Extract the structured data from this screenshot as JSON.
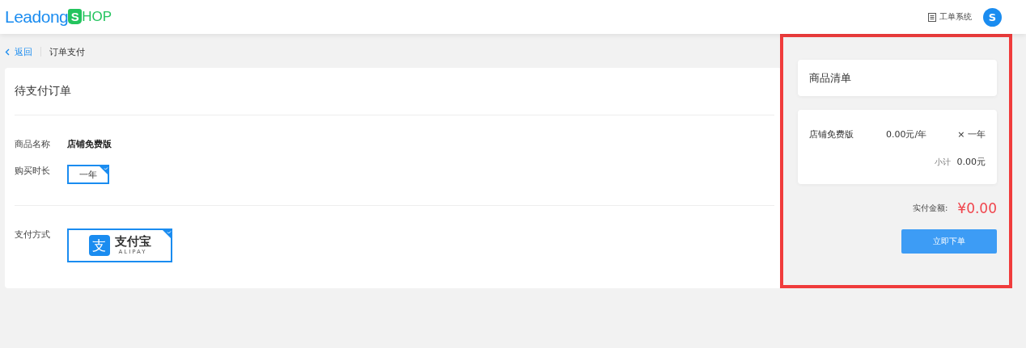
{
  "header": {
    "logo": {
      "text_1": "Leadong",
      "badge": "S",
      "text_2": "HOP"
    },
    "ticket_link": "工单系统",
    "avatar": "S"
  },
  "breadcrumb": {
    "back": "返回",
    "current": "订单支付"
  },
  "order": {
    "title": "待支付订单",
    "product": {
      "label": "商品名称",
      "value": "店铺免费版"
    },
    "duration": {
      "label": "购买时长",
      "options": [
        {
          "label": "一年",
          "selected": true
        }
      ]
    },
    "payment": {
      "label": "支付方式",
      "options": [
        {
          "kind": "alipay",
          "icon_text": "支",
          "name": "支付宝",
          "sub": "ALIPAY",
          "selected": true
        }
      ]
    }
  },
  "cart": {
    "title": "商品清单",
    "items": [
      {
        "name": "店铺免费版",
        "price": "0.00元/年",
        "qty": "× 一年",
        "subtotal_label": "小计",
        "subtotal": "0.00元"
      }
    ],
    "total_label": "实付金额:",
    "total": "¥0.00",
    "submit": "立即下单"
  }
}
